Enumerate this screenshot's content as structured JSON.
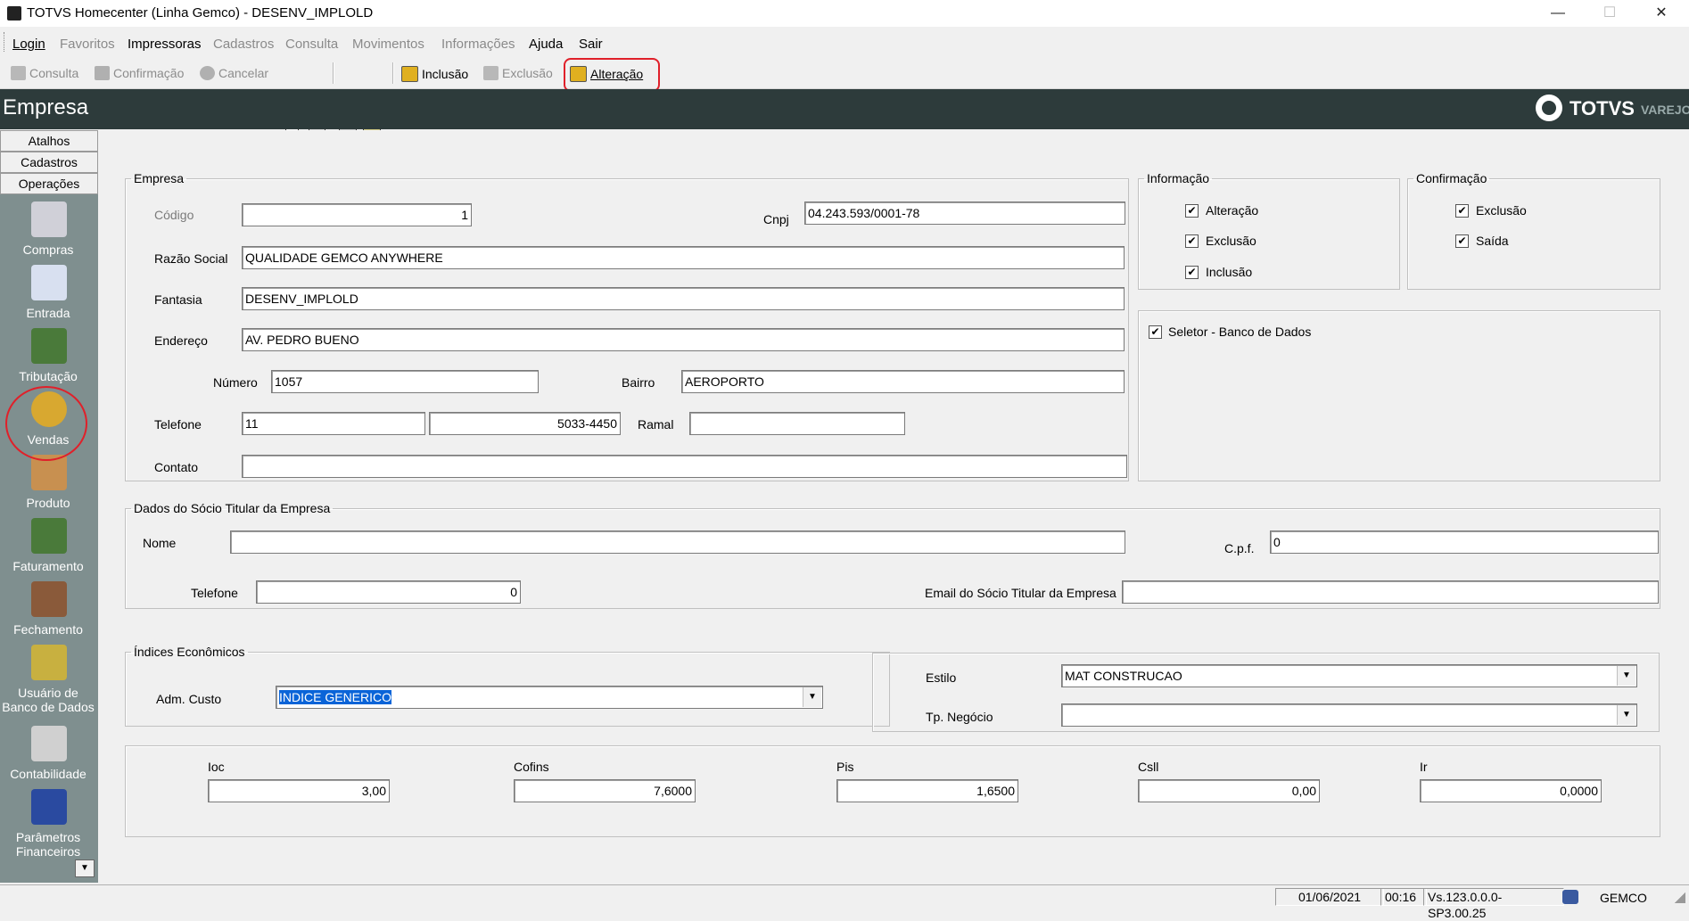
{
  "window": {
    "title": "TOTVS Homecenter (Linha Gemco) - DESENV_IMPLOLD",
    "min": "—",
    "max": "☐",
    "close": "✕"
  },
  "menubar": {
    "login": "Login",
    "favoritos": "Favoritos",
    "impressoras": "Impressoras",
    "cadastros": "Cadastros",
    "consulta": "Consulta",
    "movimentos": "Movimentos",
    "informacoes": "Informações",
    "ajuda": "Ajuda",
    "sair": "Sair"
  },
  "toolbar": {
    "consulta": "Consulta",
    "confirmacao": "Confirmação",
    "cancelar": "Cancelar",
    "inclusao": "Inclusão",
    "exclusao": "Exclusão",
    "alteracao": "Alteração"
  },
  "header": {
    "title": "Empresa",
    "brand": "TOTVS",
    "brand_sub": "VAREJO"
  },
  "sidebar": {
    "tabs": [
      "Atalhos",
      "Cadastros",
      "Operações"
    ],
    "items": [
      "Compras",
      "Entrada",
      "Tributação",
      "Vendas",
      "Produto",
      "Faturamento",
      "Fechamento",
      "Usuário de Banco de Dados",
      "Contabilidade",
      "Parâmetros Financeiros"
    ]
  },
  "empresa": {
    "legend": "Empresa",
    "codigo_label": "Código",
    "codigo": "1",
    "cnpj_label": "Cnpj",
    "cnpj": "04.243.593/0001-78",
    "razao_label": "Razão Social",
    "razao": "QUALIDADE GEMCO ANYWHERE",
    "fantasia_label": "Fantasia",
    "fantasia": "DESENV_IMPLOLD",
    "endereco_label": "Endereço",
    "endereco": "AV. PEDRO BUENO",
    "numero_label": "Número",
    "numero": "1057",
    "bairro_label": "Bairro",
    "bairro": "AEROPORTO",
    "telefone_label": "Telefone",
    "ddd": "11",
    "telefone": "5033-4450",
    "ramal_label": "Ramal",
    "ramal": "",
    "contato_label": "Contato",
    "contato": ""
  },
  "informacao": {
    "legend": "Informação",
    "items": [
      "Alteração",
      "Exclusão",
      "Inclusão"
    ]
  },
  "confirmacao": {
    "legend": "Confirmação",
    "items": [
      "Exclusão",
      "Saída"
    ]
  },
  "seletor": {
    "label": "Seletor - Banco de Dados"
  },
  "socio": {
    "legend": "Dados do Sócio Titular da Empresa",
    "nome_label": "Nome",
    "nome": "",
    "cpf_label": "C.p.f.",
    "cpf": "0",
    "telefone_label": "Telefone",
    "telefone": "0",
    "email_label": "Email do Sócio Titular da Empresa",
    "email": ""
  },
  "indices": {
    "legend": "Índices Econômicos",
    "adm_label": "Adm. Custo",
    "adm": "INDICE GENERICO"
  },
  "estilo": {
    "estilo_label": "Estilo",
    "estilo": "MAT CONSTRUCAO",
    "tp_label": "Tp. Negócio",
    "tp": ""
  },
  "impostos": [
    {
      "label": "Ioc",
      "value": "3,00"
    },
    {
      "label": "Cofins",
      "value": "7,6000"
    },
    {
      "label": "Pis",
      "value": "1,6500"
    },
    {
      "label": "Csll",
      "value": "0,00"
    },
    {
      "label": "Ir",
      "value": "0,0000"
    }
  ],
  "status": {
    "date": "01/06/2021",
    "time": "00:16",
    "version": "Vs.123.0.0.0-SP3.00.25",
    "user": "GEMCO"
  }
}
